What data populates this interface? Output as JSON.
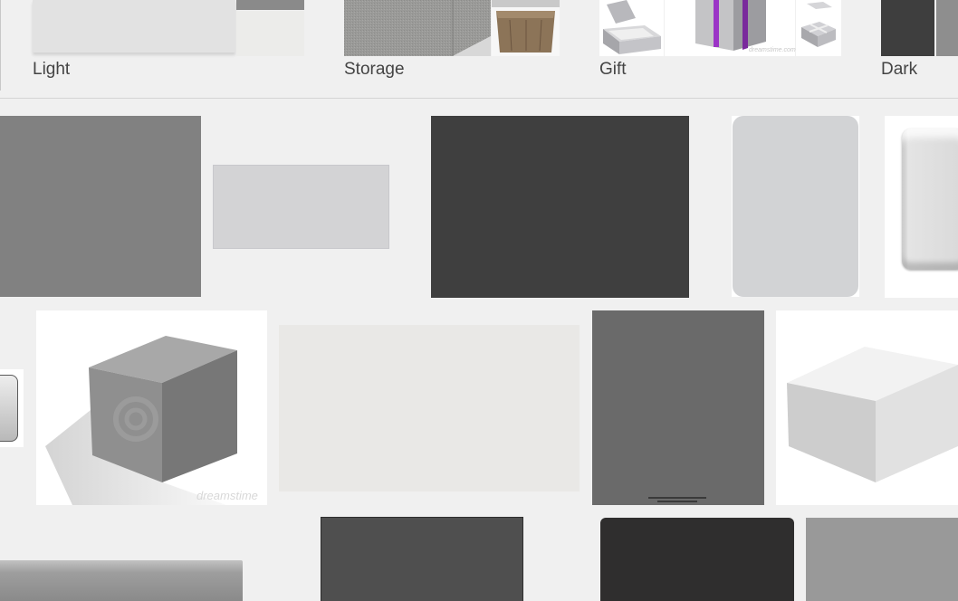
{
  "suggestions": [
    {
      "label": "Light"
    },
    {
      "label": "Storage"
    },
    {
      "label": "Gift"
    },
    {
      "label": "Dark"
    }
  ],
  "watermarks": {
    "cube_large": "dreamstime",
    "gift_small": "dreamstime.com"
  },
  "colors": {
    "page_bg": "#f0f0f0",
    "gift_ribbon": "#9b34c6"
  },
  "results": [
    {
      "id": "r1",
      "color": "#818181"
    },
    {
      "id": "r2",
      "color": "#d3d3d5"
    },
    {
      "id": "r3",
      "color": "#3f3f3f"
    },
    {
      "id": "r4",
      "color": "#d2d3d5"
    },
    {
      "id": "r5",
      "kind": "beveled-square"
    },
    {
      "id": "r6",
      "kind": "grey-cube"
    },
    {
      "id": "r7",
      "color": "#e9e8e6"
    },
    {
      "id": "r8",
      "color": "#6a6a6a"
    },
    {
      "id": "r9",
      "kind": "white-cube"
    },
    {
      "id": "r10",
      "kind": "gradient-bar"
    },
    {
      "id": "r11",
      "color": "#4f4f4f"
    },
    {
      "id": "r12",
      "color": "#2f2e2e"
    },
    {
      "id": "r13",
      "color": "#999999"
    }
  ]
}
